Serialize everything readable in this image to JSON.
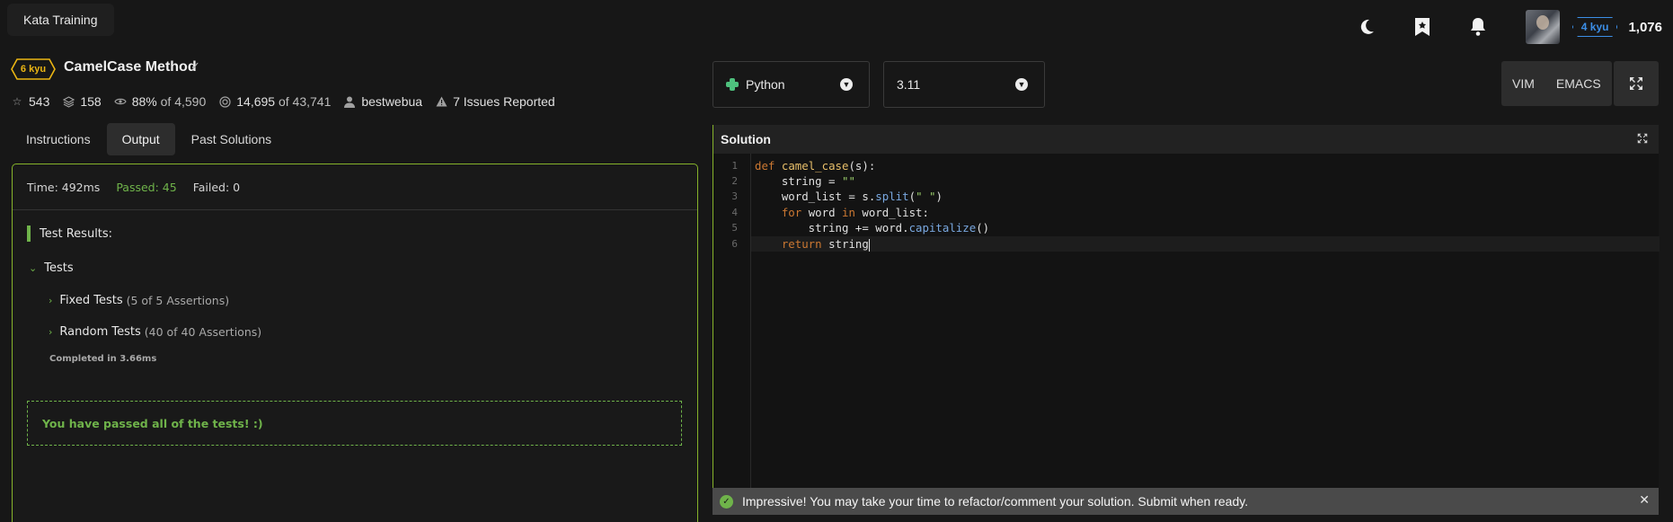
{
  "topbar": {
    "brand": "Kata Training",
    "rank": "4 kyu",
    "honor": "1,076",
    "icons": [
      "moon-icon",
      "bookmark-icon",
      "bell-icon"
    ]
  },
  "kata": {
    "kyu": "6 kyu",
    "title": "CamelCase Method",
    "stats": {
      "stars": "543",
      "collections": "158",
      "satisfaction": "88%",
      "satisfaction_of": "of 4,590",
      "completed": "14,695",
      "completed_of": "of 43,741",
      "author": "bestwebua",
      "issues": "7 Issues Reported"
    }
  },
  "tabs": [
    "Instructions",
    "Output",
    "Past Solutions"
  ],
  "output": {
    "time": "Time: 492ms",
    "passed": "Passed: 45",
    "failed": "Failed: 0",
    "results_title": "Test Results:",
    "group": "Tests",
    "fixed": "Fixed Tests",
    "fixed_note": "(5 of 5 Assertions)",
    "random": "Random Tests",
    "random_note": "(40 of 40 Assertions)",
    "completed": "Completed in 3.66ms",
    "pass_message": "You have passed all of the tests! :)"
  },
  "editor": {
    "language": "Python",
    "version": "3.11",
    "modes": [
      "VIM",
      "EMACS"
    ],
    "panel_title": "Solution",
    "line_numbers": [
      "1",
      "2",
      "3",
      "4",
      "5",
      "6"
    ]
  },
  "toast": {
    "message": "Impressive! You may take your time to refactor/comment your solution. Submit when ready."
  },
  "colors": {
    "accent_green": "#86b32b",
    "pass_green": "#6fb34a",
    "kyu_yellow": "#ecb613",
    "rank_blue": "#3c8ee6"
  }
}
